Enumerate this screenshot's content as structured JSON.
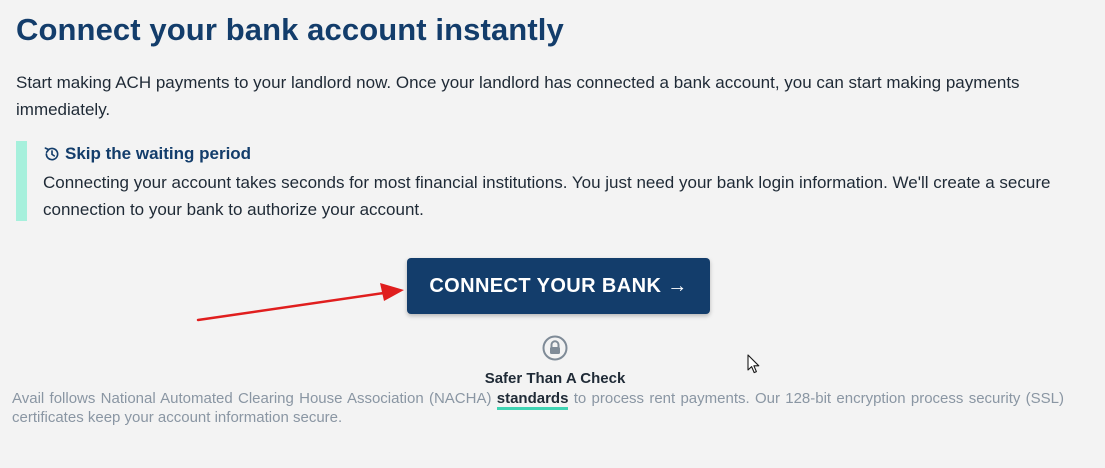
{
  "header": {
    "title": "Connect your bank account instantly"
  },
  "intro": {
    "text": "Start making ACH payments to your landlord now. Once your landlord has connected a bank account, you can start making payments immediately."
  },
  "callout": {
    "icon": "history-clock-icon",
    "title": "Skip the waiting period",
    "body": "Connecting your account takes seconds for most financial institutions. You just need your bank login information. We'll create a secure connection to your bank to authorize your account.",
    "accent_color": "#a6f0dc"
  },
  "cta": {
    "label": "CONNECT YOUR BANK →",
    "background_color": "#133d6b",
    "annotation_arrow_color": "#e01e1e"
  },
  "security": {
    "icon": "lock-icon",
    "title": "Safer Than A Check",
    "disclaimer_before": "Avail follows National Automated Clearing House Association (NACHA) ",
    "link_label": "standards",
    "disclaimer_after": " to process rent payments. Our 128-bit encryption process security (SSL) certificates keep your account information secure.",
    "link_underline_color": "#3fd3b3"
  },
  "colors": {
    "brand_navy": "#133d6b",
    "page_background": "#f3f3f3",
    "muted_text": "#8a96a3"
  }
}
